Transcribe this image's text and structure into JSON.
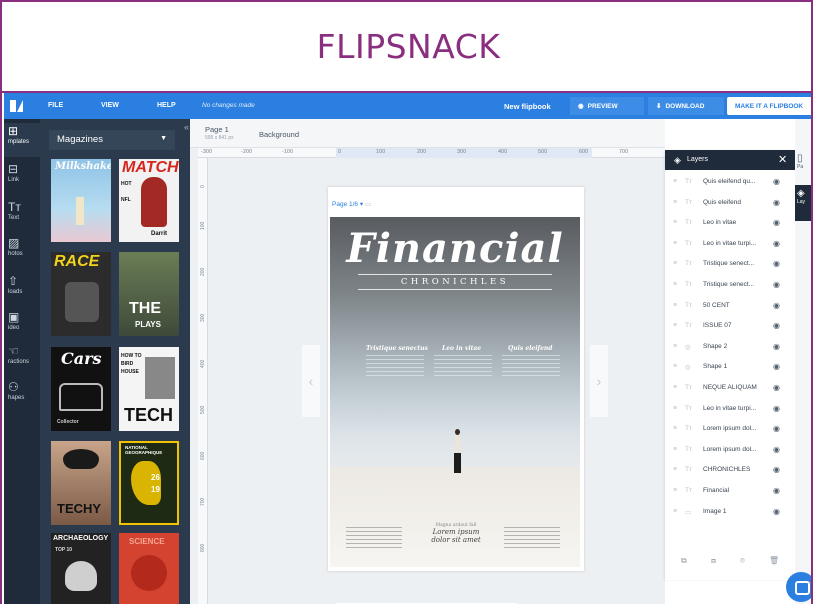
{
  "brand": {
    "title": "FLIPSNACK",
    "color": "#8a2f7f"
  },
  "topbar": {
    "menu": [
      "FILE",
      "VIEW",
      "HELP"
    ],
    "status": "No changes made",
    "doc_title": "New flipbook",
    "preview": "PREVIEW",
    "download": "DOWNLOAD",
    "make": "MAKE IT A FLIPBOOK",
    "color": "#2a7fe0"
  },
  "rail": {
    "items": [
      "mplates",
      "Link",
      "Text",
      "hotos",
      "loads",
      "ideo",
      "ractions",
      "hapes"
    ]
  },
  "templates": {
    "category": "Magazines",
    "covers": [
      {
        "name": "Milkshake"
      },
      {
        "name": "MATCH",
        "lines": [
          "HOT",
          "NFL",
          "Darrit"
        ]
      },
      {
        "name": "RACE"
      },
      {
        "name": "THE",
        "sub": "PLAYS"
      },
      {
        "name": "Cars",
        "sub": "Collector"
      },
      {
        "name": "TECH",
        "lines": [
          "HOW TO",
          "BIRD",
          "HOUSE"
        ]
      },
      {
        "name": "TECHY"
      },
      {
        "name": "NATIONAL GEOGRAPHIQUE",
        "lines": [
          "26",
          "19"
        ]
      },
      {
        "name": "ARCHAEOLOGY",
        "sub": "TOP 10"
      },
      {
        "name": "SCIENCE"
      }
    ]
  },
  "workspace": {
    "page_tab": "Page 1",
    "page_size": "595 x 841 px",
    "background_tab": "Background",
    "ruler_h": [
      "-300",
      "-200",
      "-100",
      "0",
      "100",
      "200",
      "300",
      "400",
      "500",
      "600",
      "700"
    ],
    "ruler_v": [
      "0",
      "100",
      "200",
      "300",
      "400",
      "500",
      "600",
      "700",
      "800"
    ],
    "page_indicator": "Page 1/6"
  },
  "cover": {
    "masthead": "Financial",
    "subtitle": "CHRONICHLES",
    "headings": [
      "Tristique senectus",
      "Leo in vitae",
      "Quis eleifend"
    ],
    "footer_center": [
      "Magna ardaut fall",
      "Lorem ipsum",
      "dolor sit amet"
    ]
  },
  "layers": {
    "title": "Layers",
    "items": [
      {
        "kind": "Tт",
        "name": "Quis eleifend qu..."
      },
      {
        "kind": "Tт",
        "name": "Quis eleifend"
      },
      {
        "kind": "Tт",
        "name": "Leo in vitae"
      },
      {
        "kind": "Tт",
        "name": "Leo in vitae turpi..."
      },
      {
        "kind": "Tт",
        "name": "Tristique senect..."
      },
      {
        "kind": "Tт",
        "name": "Tristique senect..."
      },
      {
        "kind": "Tт",
        "name": "50 CENT"
      },
      {
        "kind": "Tт",
        "name": "ISSUE 07"
      },
      {
        "kind": "◎",
        "name": "Shape 2"
      },
      {
        "kind": "◎",
        "name": "Shape 1"
      },
      {
        "kind": "Tт",
        "name": "NEQUE ALIQUAM"
      },
      {
        "kind": "Tт",
        "name": "Leo in vitae turpi..."
      },
      {
        "kind": "Tт",
        "name": "Lorem ipsum dol..."
      },
      {
        "kind": "Tт",
        "name": "Lorem ipsum dol..."
      },
      {
        "kind": "Tт",
        "name": "CHRONICHLES"
      },
      {
        "kind": "Tт",
        "name": "Financial"
      },
      {
        "kind": "▭",
        "name": "Image 1"
      }
    ]
  },
  "rstrip": {
    "a": "Pa",
    "b": "Lay"
  }
}
